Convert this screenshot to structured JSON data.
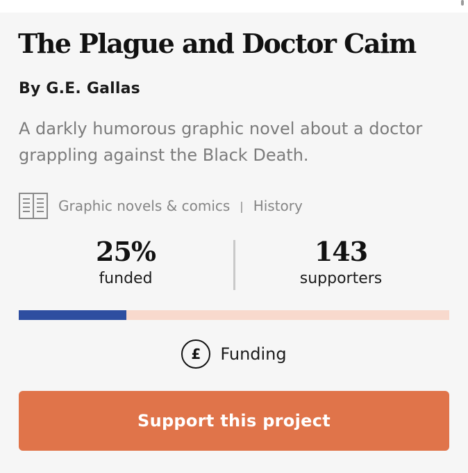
{
  "project": {
    "title": "The Plague and Doctor Caim",
    "author": "By G.E. Gallas",
    "description": "A darkly humorous graphic novel about a doctor grappling against the Black Death.",
    "category_icon": "open-book-icon",
    "categories": [
      "Graphic novels & comics",
      "History"
    ],
    "category_separator": "|"
  },
  "stats": {
    "funded_value": "25%",
    "funded_label": "funded",
    "supporters_value": "143",
    "supporters_label": "supporters"
  },
  "progress": {
    "fraction": 0.25,
    "fill_color": "#2e4ea0",
    "track_color": "#f8d9cd"
  },
  "status": {
    "icon": "pound-icon",
    "icon_glyph": "£",
    "label": "Funding"
  },
  "cta": {
    "label": "Support this project",
    "color": "#e0744a"
  }
}
